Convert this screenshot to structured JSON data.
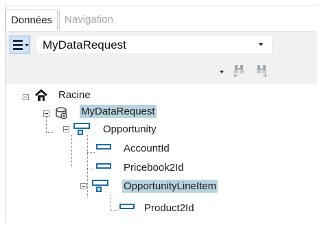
{
  "tabs": [
    {
      "label": "Données",
      "active": true
    },
    {
      "label": "Navigation",
      "active": false
    }
  ],
  "toolbar": {
    "menu_icon": "hamburger-menu-icon",
    "request_combo_value": "MyDataRequest"
  },
  "tree": {
    "root": {
      "label": "Racine",
      "icon": "home-icon",
      "expanded": true
    },
    "request": {
      "label": "MyDataRequest",
      "icon": "data-request-icon",
      "selected": true,
      "expanded": true
    },
    "opportunity": {
      "label": "Opportunity",
      "icon": "object-icon",
      "expanded": true
    },
    "fields": [
      {
        "label": "AccountId",
        "icon": "field-icon"
      },
      {
        "label": "Pricebook2Id",
        "icon": "field-icon"
      }
    ],
    "line_item": {
      "label": "OpportunityLineItem",
      "icon": "object-icon",
      "selected": true,
      "expanded": true
    },
    "line_item_fields": [
      {
        "label": "Product2Id",
        "icon": "field-icon"
      }
    ]
  },
  "colors": {
    "selection": "#b7d3de",
    "accent": "#1c6ea4"
  }
}
